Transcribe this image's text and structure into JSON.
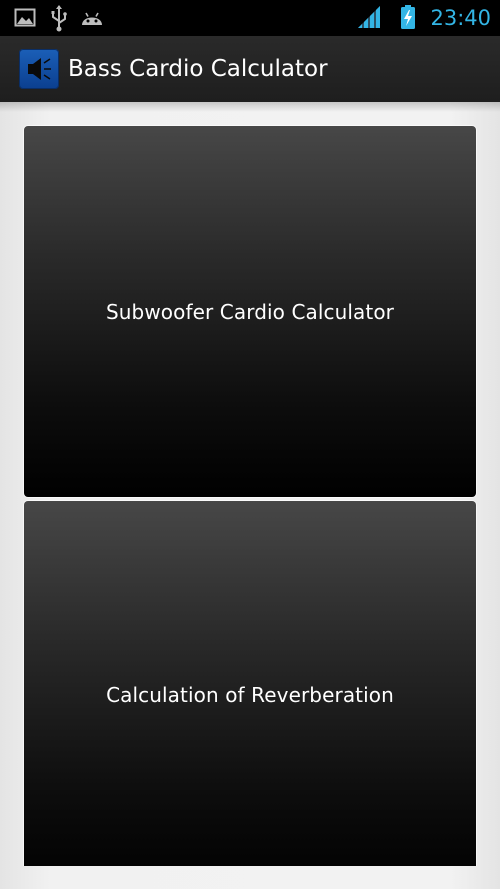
{
  "status_bar": {
    "time": "23:40",
    "icons": [
      "gallery-icon",
      "usb-icon",
      "android-debug-icon",
      "signal-icon",
      "battery-charging-icon"
    ],
    "colors": {
      "time": "#33b5e5",
      "signal": "#33b5e5",
      "battery": "#33b5e5"
    }
  },
  "action_bar": {
    "icon": "speaker-icon",
    "title": "Bass Cardio Calculator"
  },
  "main": {
    "buttons": [
      {
        "label": "Subwoofer Cardio Calculator"
      },
      {
        "label": "Calculation of Reverberation"
      }
    ]
  }
}
